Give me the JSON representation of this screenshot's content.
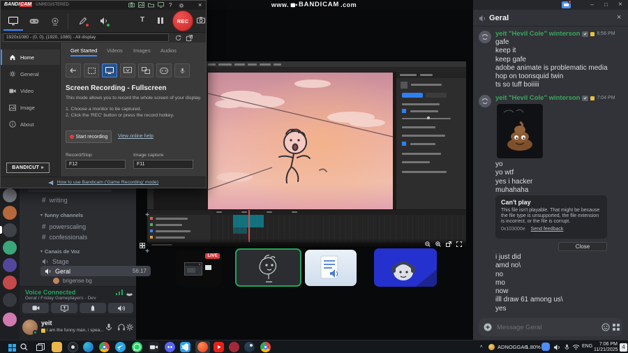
{
  "watermark": {
    "pre": "www.",
    "brand": "BANDICAM",
    "post": ".com"
  },
  "bandicam": {
    "brand_a": "BANDI",
    "brand_b": "CAM",
    "unregistered": "UNREGISTERED",
    "rec": "REC",
    "display": "1920x1080 - (0, 0), (1920, 1080) - All display",
    "nav": [
      "Home",
      "General",
      "Video",
      "Image",
      "About"
    ],
    "tabs": [
      "Get Started",
      "Videos",
      "Images",
      "Audios"
    ],
    "mode_title": "Screen Recording - Fullscreen",
    "mode_desc": "This mode allows you to record the whole screen of your display.",
    "step1": "1. Choose a monitor to be captured.",
    "step2": "2. Click the 'REC' button or press the record hotkey.",
    "start": "Start recording",
    "help": "View online help",
    "hk1_label": "Record/Stop",
    "hk1": "F12",
    "hk2_label": "Image capture",
    "hk2": "F11",
    "bandicut": "BANDICUT »",
    "tip": "How to use Bandicam ('Game Recording' mode)"
  },
  "sidebar": {
    "writing": "writing",
    "cat_funny": "funny channels",
    "powerscaling": "powerscaling",
    "confessionals": "confessionals",
    "cat_voice": "Canais de Voz",
    "stage": "Stage",
    "geral": "Geral",
    "timer": "56:17",
    "member": "brigense bg",
    "voice_status": "Voice Connected",
    "voice_detail": "Geral / Friday Gameplayers - Dev",
    "user": "yeit",
    "status": "i am the funny man, i spea..."
  },
  "stream": {
    "live": "LIVE"
  },
  "chat": {
    "title": "Geral",
    "g1_author": "yeit \"Hevil Cole\" winterson",
    "g1_time": "6:56 PM",
    "g1": [
      "gafe",
      "keep it",
      "keep gafe",
      "adobe animate is problematic media",
      "hop on toonsquid twin",
      "ts so tuff boiiiii"
    ],
    "g2_author": "yeit \"Hevil Cole\" winterson",
    "g2_time": "7:04 PM",
    "g2": [
      "yo",
      "yo wtf",
      "yes i hacker",
      "muhahaha"
    ],
    "embed_title": "Can't play",
    "embed_body": "This file isn't playable. That might be because the file type is unsupported, the file extension is incorrect, or the file is corrupt.",
    "embed_code": "0x103000e",
    "embed_feedback": "Send feedback",
    "embed_close": "Close",
    "g3": [
      "i just did",
      "amd no\\",
      "no",
      "mo",
      "now",
      "illl draw 61 among us\\",
      "yes"
    ],
    "placeholder": "Message Geral"
  },
  "taskbar": {
    "ticker": "ADNOGGAS",
    "change": "-1.80%",
    "lang": "ENG",
    "time": "7:06 PM",
    "date": "11/21/2025",
    "badge": "4"
  }
}
